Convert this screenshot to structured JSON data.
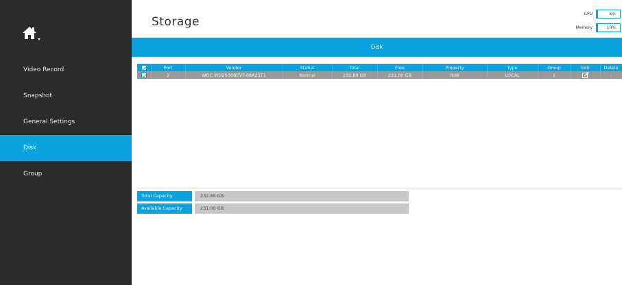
{
  "sidebar": {
    "home_icon": "home-icon",
    "items": [
      {
        "label": "Video Record",
        "active": false
      },
      {
        "label": "Snapshot",
        "active": false
      },
      {
        "label": "General Settings",
        "active": false
      },
      {
        "label": "Disk",
        "active": true
      },
      {
        "label": "Group",
        "active": false
      }
    ]
  },
  "header": {
    "title": "Storage",
    "cpu_label": "CPU",
    "cpu_value": "5%",
    "memory_label": "Memory",
    "memory_value": "10%"
  },
  "disk_bar": {
    "label": "Disk"
  },
  "table": {
    "columns": [
      "Port",
      "Vendor",
      "Status",
      "Total",
      "Free",
      "Property",
      "Type",
      "Group",
      "Edit",
      "Delete"
    ],
    "rows": [
      {
        "checked": true,
        "port": "2",
        "vendor": "WDC WD2500BEVT-08A23T1",
        "status": "Normal",
        "total": "232.89 GB",
        "free": "231.00 GB",
        "property": "R/W",
        "type": "LOCAL",
        "group": "1",
        "edit_icon": "edit-icon",
        "delete": "-"
      }
    ],
    "header_checked": true
  },
  "capacity": {
    "total_label": "Total Capacity",
    "total_value": "232.89 GB",
    "available_label": "Available Capacity",
    "available_value": "231.00 GB"
  },
  "colors": {
    "accent": "#0ba3df",
    "sidebar_bg": "#2b2b2b",
    "row_bg": "#999999",
    "capacity_bg": "#c8c8c8"
  }
}
